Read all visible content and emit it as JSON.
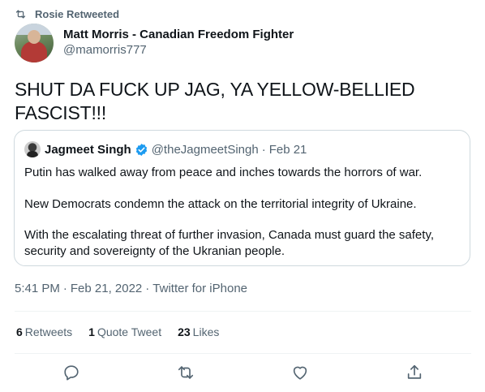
{
  "retweet": {
    "label": "Rosie Retweeted",
    "icon": "retweet-icon"
  },
  "author": {
    "display_name": "Matt Morris - Canadian Freedom Fighter",
    "handle": "@mamorris777"
  },
  "tweet": {
    "text": "SHUT DA FUCK UP JAG, YA YELLOW-BELLIED FASCIST!!!"
  },
  "quote": {
    "name": "Jagmeet Singh",
    "handle": "@theJagmeetSingh",
    "separator": "·",
    "date": "Feb 21",
    "paragraphs": [
      "Putin has walked away from peace and inches towards the horrors of war.",
      "New Democrats condemn the attack on the territorial integrity of Ukraine.",
      "With the escalating threat of further invasion, Canada must guard the safety, security and sovereignty of the Ukranian people."
    ],
    "verified_color": "#1d9bf0"
  },
  "meta": {
    "time": "5:41 PM",
    "separator": "·",
    "date": "Feb 21, 2022",
    "client": "Twitter for iPhone"
  },
  "stats": {
    "retweets_count": "6",
    "retweets_label": "Retweets",
    "quotes_count": "1",
    "quotes_label": "Quote Tweet",
    "likes_count": "23",
    "likes_label": "Likes"
  },
  "actions": [
    "reply-icon",
    "retweet-icon",
    "like-icon",
    "share-icon"
  ],
  "colors": {
    "text": "#0f1419",
    "secondary": "#536471",
    "border": "#cfd9de",
    "divider": "#eff3f4"
  }
}
